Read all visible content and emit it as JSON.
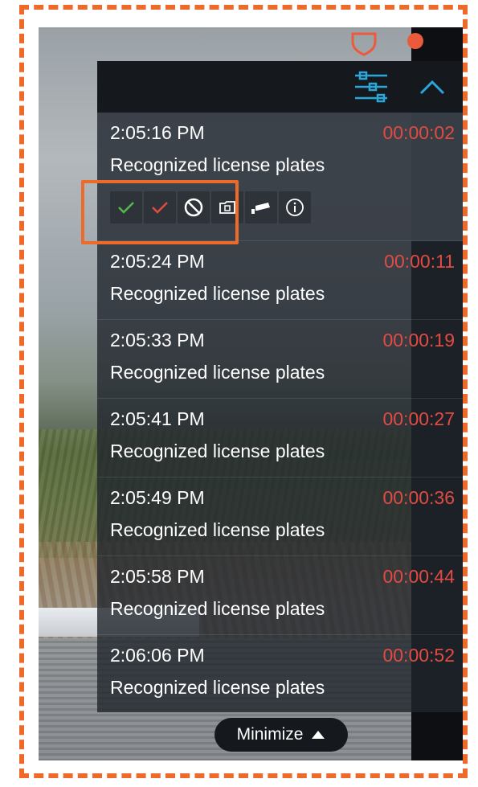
{
  "events": [
    {
      "time": "2:05:16 PM",
      "label": "Recognized license plates",
      "duration": "00:00:02"
    },
    {
      "time": "2:05:24 PM",
      "label": "Recognized license plates",
      "duration": "00:00:11"
    },
    {
      "time": "2:05:33 PM",
      "label": "Recognized license plates",
      "duration": "00:00:19"
    },
    {
      "time": "2:05:41 PM",
      "label": "Recognized license plates",
      "duration": "00:00:27"
    },
    {
      "time": "2:05:49 PM",
      "label": "Recognized license plates",
      "duration": "00:00:36"
    },
    {
      "time": "2:05:58 PM",
      "label": "Recognized license plates",
      "duration": "00:00:44"
    },
    {
      "time": "2:06:06 PM",
      "label": "Recognized license plates",
      "duration": "00:00:52"
    }
  ],
  "actions": [
    {
      "icon": "checkmark-green-icon"
    },
    {
      "icon": "checkmark-red-icon"
    },
    {
      "icon": "block-icon"
    },
    {
      "icon": "folder-icon"
    },
    {
      "icon": "camera-icon"
    },
    {
      "icon": "info-icon"
    }
  ],
  "minimize_label": "Minimize",
  "colors": {
    "accent": "#2aa6d9",
    "duration": "#e34b42",
    "highlight": "#ee6a2a",
    "confirm": "#52b84c"
  }
}
